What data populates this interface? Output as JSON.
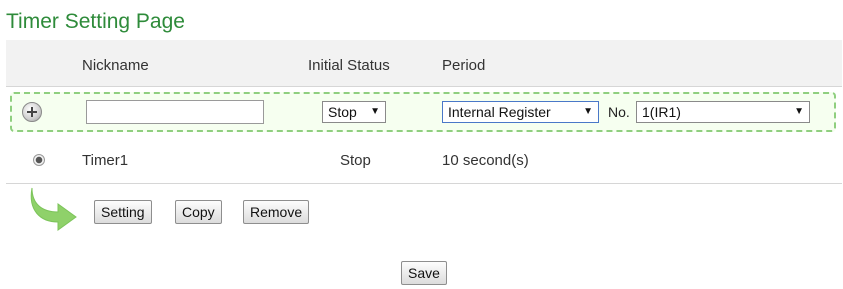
{
  "page": {
    "title": "Timer Setting Page"
  },
  "table": {
    "headers": {
      "nickname": "Nickname",
      "initial_status": "Initial Status",
      "period": "Period"
    },
    "add_row": {
      "nickname_value": "",
      "status_value": "Stop",
      "period_source": "Internal Register",
      "no_label": "No.",
      "no_value": "1(IR1)"
    },
    "rows": [
      {
        "nickname": "Timer1",
        "status": "Stop",
        "period": "10 second(s)"
      }
    ]
  },
  "actions": {
    "setting": "Setting",
    "copy": "Copy",
    "remove": "Remove"
  },
  "footer": {
    "save": "Save"
  },
  "colors": {
    "title": "#2e8b3a",
    "add_border": "#8fcf7f",
    "arrow": "#8fd16a"
  }
}
